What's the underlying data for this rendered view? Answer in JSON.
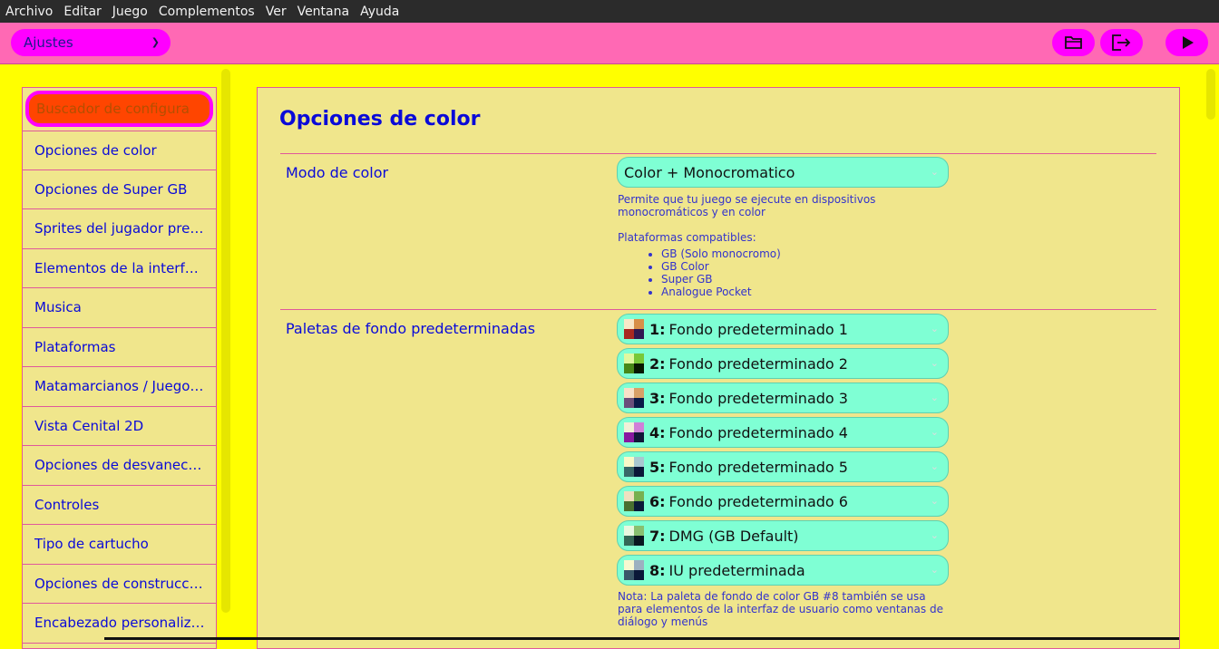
{
  "menubar": {
    "items": [
      "Archivo",
      "Editar",
      "Juego",
      "Complementos",
      "Ver",
      "Ventana",
      "Ayuda"
    ]
  },
  "toolbar": {
    "section_select": "Ajustes",
    "buttons": [
      {
        "name": "open-folder-icon"
      },
      {
        "name": "export-icon"
      },
      {
        "name": "play-icon"
      }
    ]
  },
  "sidebar": {
    "search_placeholder": "Buscador de configura",
    "items": [
      "Opciones de color",
      "Opciones de Super GB",
      "Sprites del jugador predeterminados",
      "Elementos de la interfaz de usuario",
      "Musica",
      "Plataformas",
      "Matamarcianos / Juego de naves",
      "Vista Cenital 2D",
      "Opciones de desvanecimiento",
      "Controles",
      "Tipo de cartucho",
      "Opciones de construcción",
      "Encabezado personalizado"
    ]
  },
  "main": {
    "title": "Opciones de color",
    "color_mode": {
      "label": "Modo de color",
      "value": "Color + Monocromatico",
      "description": "Permite que tu juego se ejecute en dispositivos monocromáticos y en color",
      "platforms_title": "Plataformas compatibles:",
      "platforms": [
        "GB (Solo monocromo)",
        "GB Color",
        "Super GB",
        "Analogue Pocket"
      ]
    },
    "palettes": {
      "label": "Paletas de fondo predeterminadas",
      "items": [
        {
          "num": "1:",
          "name": "Fondo predeterminado 1",
          "colors": [
            "#f8e8c8",
            "#d89048",
            "#a82820",
            "#301850"
          ]
        },
        {
          "num": "2:",
          "name": "Fondo predeterminado 2",
          "colors": [
            "#e0f8a0",
            "#78c838",
            "#488818",
            "#081800"
          ]
        },
        {
          "num": "3:",
          "name": "Fondo predeterminado 3",
          "colors": [
            "#f8e0c8",
            "#d8a068",
            "#6a4e7a",
            "#0a1a48"
          ]
        },
        {
          "num": "4:",
          "name": "Fondo predeterminado 4",
          "colors": [
            "#f0f0d8",
            "#d080d8",
            "#8818a0",
            "#101838"
          ]
        },
        {
          "num": "5:",
          "name": "Fondo predeterminado 5",
          "colors": [
            "#f8f8c8",
            "#a8c8d0",
            "#386868",
            "#0a1838"
          ]
        },
        {
          "num": "6:",
          "name": "Fondo predeterminado 6",
          "colors": [
            "#f0e0c0",
            "#78b050",
            "#4a7030",
            "#0a1a38"
          ]
        },
        {
          "num": "7:",
          "name": "DMG (GB Default)",
          "colors": [
            "#e8f8e0",
            "#88c070",
            "#346856",
            "#081820"
          ]
        },
        {
          "num": "8:",
          "name": "IU predeterminada",
          "colors": [
            "#f8f8d0",
            "#9cb0c0",
            "#3a5868",
            "#0a1838"
          ]
        }
      ],
      "note": "Nota: La paleta de fondo de color GB #8 también se usa para elementos de la interfaz de usuario como ventanas de diálogo y menús"
    }
  },
  "colors": {
    "accent": "#ff00ff",
    "toolbar": "#ff69b4",
    "background": "#ffff00",
    "panel": "#f0e68c",
    "link": "#0a0ad8",
    "select": "#7fffd4"
  }
}
